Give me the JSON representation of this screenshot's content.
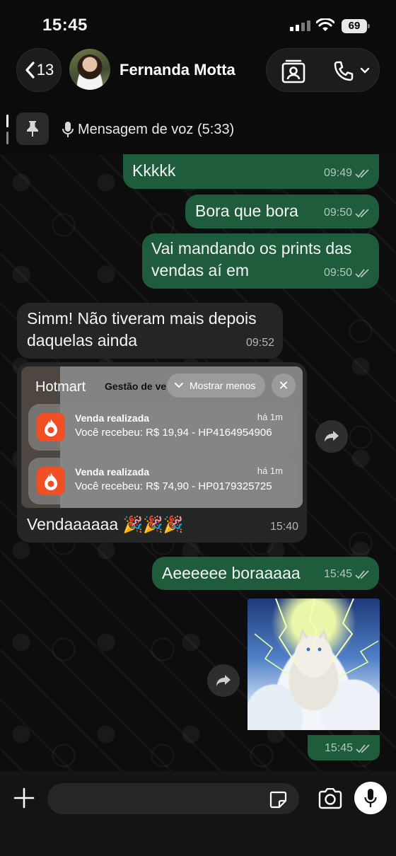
{
  "status_bar": {
    "time": "15:45",
    "battery": "69"
  },
  "header": {
    "back_count": "13",
    "contact_name": "Fernanda Motta",
    "icons": [
      "chevron-left-icon",
      "video-call-icon",
      "phone-icon",
      "chevron-down-icon"
    ]
  },
  "pinned": {
    "text": "Mensagem de voz (5:33)"
  },
  "messages": [
    {
      "direction": "out",
      "text": "Kkkkk",
      "time": "09:49"
    },
    {
      "direction": "out",
      "text": "Bora que bora",
      "time": "09:50"
    },
    {
      "direction": "out",
      "line1": "Vai mandando os prints das",
      "line2": "vendas aí em",
      "time": "09:50"
    },
    {
      "direction": "in",
      "line1": "Simm! Não tiveram mais depois",
      "line2": "daquelas ainda",
      "time": "09:52"
    },
    {
      "direction": "in",
      "caption": "Vendaaaaaa 🎉🎉🎉",
      "time": "15:40"
    },
    {
      "direction": "out",
      "text": "Aeeeeee boraaaaa",
      "time": "15:45"
    },
    {
      "direction": "out",
      "type": "image",
      "time": "15:45"
    }
  ],
  "screenshot": {
    "brand": "Hotmart",
    "sub_text": "Gestão de ve",
    "show_less": "Mostrar menos",
    "notifications": [
      {
        "title": "Venda realizada",
        "body": "Você recebeu: R$ 19,94 - HP4164954906",
        "age": "há 1m"
      },
      {
        "title": "Venda realizada",
        "body": "Você recebeu: R$ 74,90 - HP0179325725",
        "age": "há 1m"
      }
    ]
  },
  "composer": {
    "placeholder": ""
  },
  "colors": {
    "outgoing_bubble": "#1e5c3c",
    "incoming_bubble": "#242626",
    "background": "#0b0b0b"
  }
}
